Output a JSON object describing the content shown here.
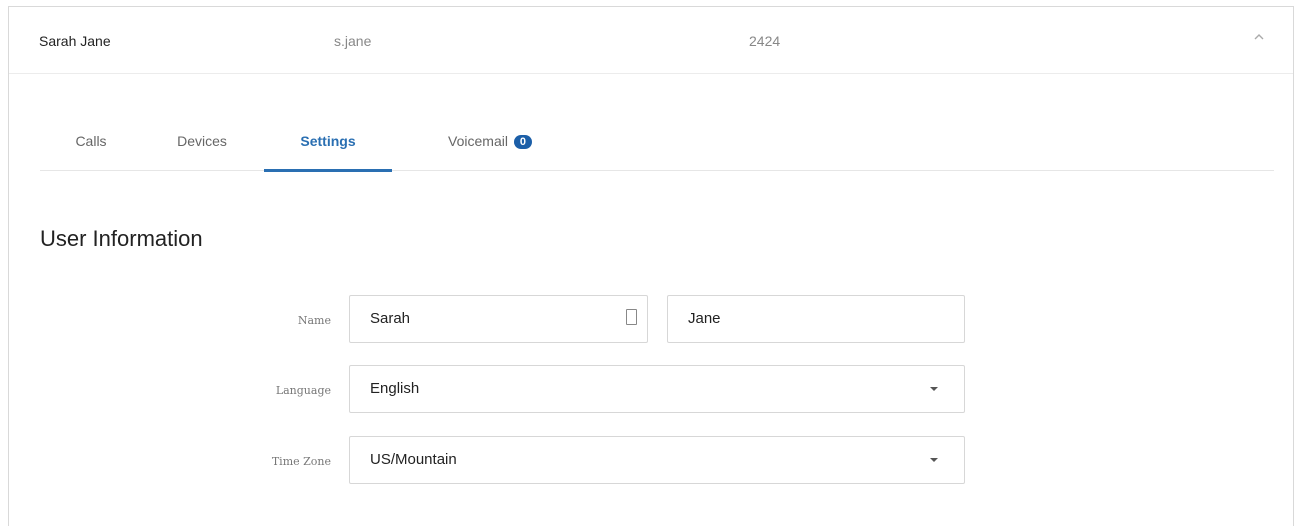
{
  "summary": {
    "name": "Sarah Jane",
    "username": "s.jane",
    "extension": "2424",
    "collapse_icon": "chevron-up-icon"
  },
  "tabs": [
    {
      "label": "Calls",
      "active": false
    },
    {
      "label": "Devices",
      "active": false
    },
    {
      "label": "Settings",
      "active": true
    },
    {
      "label": "Voicemail",
      "active": false,
      "badge": "0"
    }
  ],
  "section": {
    "title": "User Information"
  },
  "form": {
    "name_label": "Name",
    "first_name": "Sarah",
    "last_name": "Jane",
    "first_name_icon": "contact-card-icon",
    "language_label": "Language",
    "language_value": "English",
    "timezone_label": "Time Zone",
    "timezone_value": "US/Mountain"
  },
  "colors": {
    "accent": "#2a6fb2",
    "badge": "#1c5fa8",
    "border": "#d7d7d7"
  }
}
